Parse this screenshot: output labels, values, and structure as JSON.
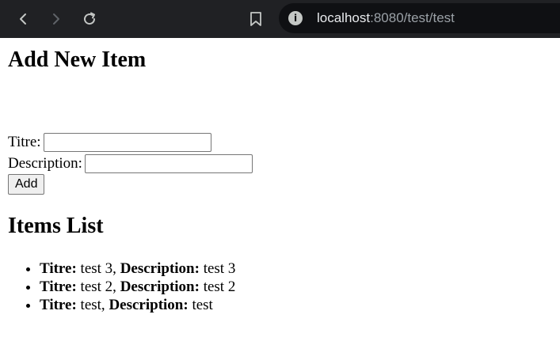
{
  "browser": {
    "url_host": "localhost",
    "url_rest": ":8080/test/test",
    "info_glyph": "i"
  },
  "form": {
    "heading": "Add New Item",
    "titre_label": "Titre:",
    "titre_value": "",
    "description_label": "Description:",
    "description_value": "",
    "add_label": "Add"
  },
  "list": {
    "heading": "Items List",
    "items": [
      {
        "titre_label": "Titre:",
        "titre": " test 3, ",
        "description_label": "Description:",
        "description": " test 3"
      },
      {
        "titre_label": "Titre:",
        "titre": " test 2, ",
        "description_label": "Description:",
        "description": " test 2"
      },
      {
        "titre_label": "Titre:",
        "titre": " test, ",
        "description_label": "Description:",
        "description": " test"
      }
    ]
  },
  "icons": {
    "back": "arrow-left-icon",
    "forward": "arrow-right-icon",
    "reload": "reload-icon",
    "bookmark": "bookmark-icon",
    "info": "info-icon"
  },
  "colors": {
    "toolbar": "#202124",
    "omnibox": "#0f1013",
    "url_host": "#e8eaed",
    "url_rest": "#9aa0a6"
  }
}
